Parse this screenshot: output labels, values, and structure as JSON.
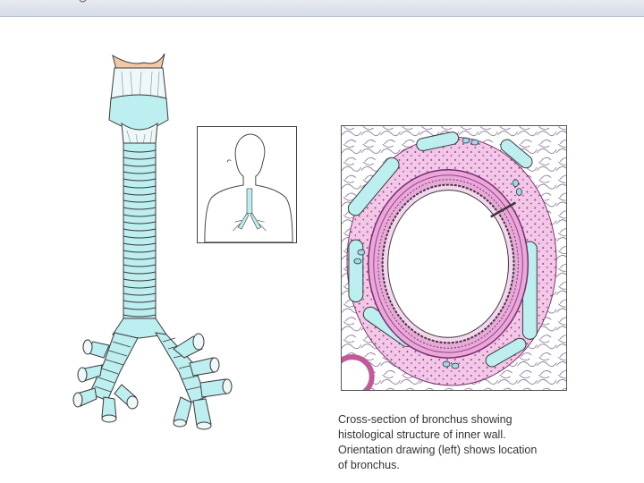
{
  "caption": {
    "lines": [
      "Cross-section of bronchus showing",
      "histological structure of inner wall.",
      "Orientation drawing (left) shows location",
      "of bronchus."
    ]
  },
  "colors": {
    "cartilage": "#bdeef0",
    "tissue": "#f4c6e8",
    "mucosa": "#e9a9d8",
    "larynx_tip": "#f2c9a6",
    "outline": "#3a3a3a",
    "header_bar": "#dde3ea"
  }
}
